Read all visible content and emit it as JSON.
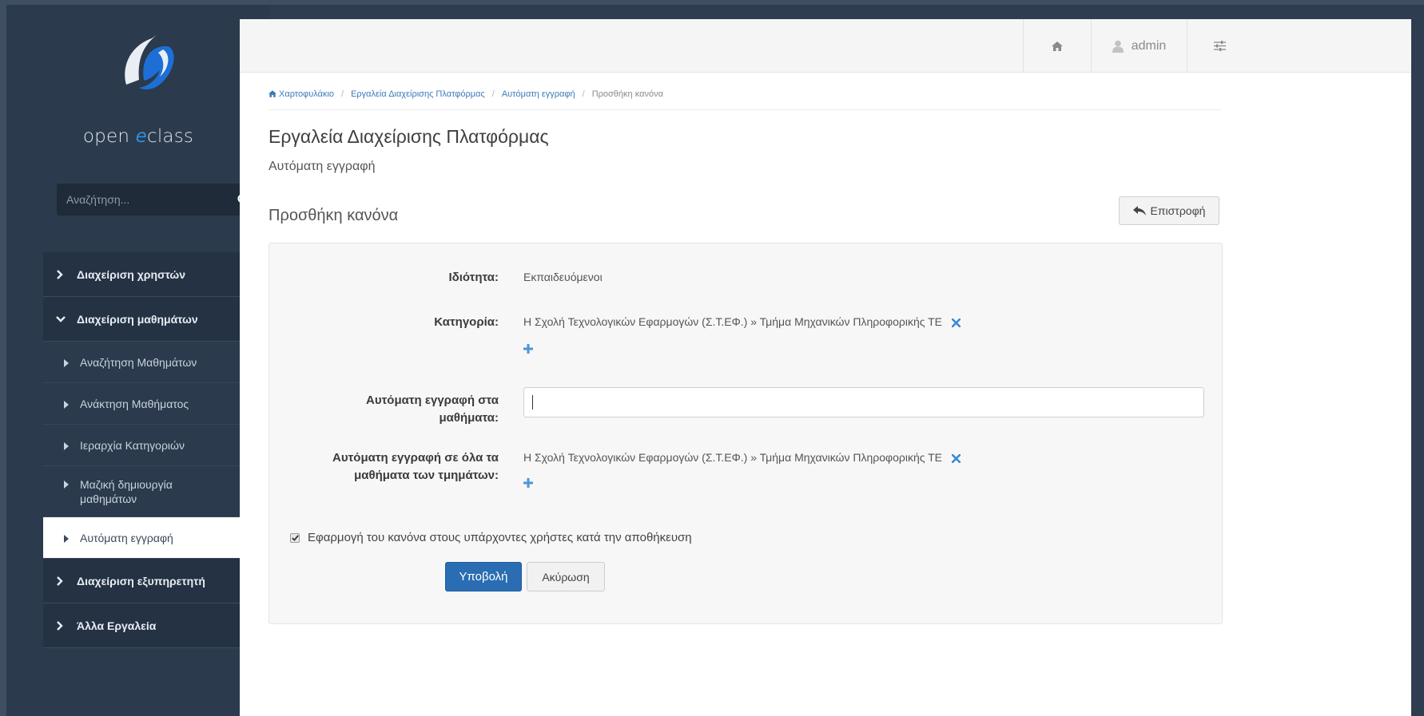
{
  "sidebar": {
    "logo_open": "open ",
    "logo_e": "e",
    "logo_class": "class",
    "search_placeholder": "Αναζήτηση...",
    "menu": [
      {
        "label": "Διαχείριση χρηστών"
      },
      {
        "label": "Διαχείριση μαθημάτων"
      },
      {
        "label": "Διαχείριση εξυπηρετητή"
      },
      {
        "label": "Άλλα Εργαλεία"
      }
    ],
    "submenu": [
      {
        "label": "Αναζήτηση Μαθημάτων"
      },
      {
        "label": "Ανάκτηση Μαθήματος"
      },
      {
        "label": "Ιεραρχία Κατηγοριών"
      },
      {
        "label": "Μαζική δημιουργία μαθημάτων"
      },
      {
        "label": "Αυτόματη εγγραφή"
      }
    ]
  },
  "topbar": {
    "user": "admin"
  },
  "breadcrumb": {
    "home": "Χαρτοφυλάκιο",
    "b1": "Εργαλεία Διαχείρισης Πλατφόρμας",
    "b2": "Αυτόματη εγγραφή",
    "current": "Προσθήκη κανόνα"
  },
  "page": {
    "title": "Εργαλεία Διαχείρισης Πλατφόρμας",
    "subtitle": "Αυτόματη εγγραφή",
    "section_title": "Προσθήκη κανόνα",
    "back_label": "Επιστροφή"
  },
  "form": {
    "property_label": "Ιδιότητα:",
    "property_value": "Εκπαιδευόμενοι",
    "category_label": "Κατηγορία:",
    "category_value": "Η Σχολή Τεχνολογικών Εφαρμογών (Σ.Τ.ΕΦ.) » Τμήμα Μηχανικών Πληροφορικής ΤΕ",
    "courses_label_1": "Αυτόματη εγγραφή στα",
    "courses_label_2": "μαθήματα:",
    "courses_input_value": "",
    "all_label_1": "Αυτόματη εγγραφή σε όλα τα",
    "all_label_2": "μαθήματα των τμημάτων:",
    "all_value": "Η Σχολή Τεχνολογικών Εφαρμογών (Σ.Τ.ΕΦ.) » Τμήμα Μηχανικών Πληροφορικής ΤΕ",
    "apply_checkbox_label": "Εφαρμογή του κανόνα στους υπάρχοντες χρήστες κατά την αποθήκευση",
    "apply_checked": true,
    "submit_label": "Υποβολή",
    "cancel_label": "Ακύρωση"
  },
  "colors": {
    "accent": "#2a6db2",
    "sidebar_bg": "#2b3a4c",
    "link": "#3d7ab8",
    "remove_x": "#3b88d6"
  },
  "icons": [
    "home-icon",
    "user-icon",
    "tune-icon",
    "search-icon",
    "reply-icon",
    "remove-icon",
    "plus-icon",
    "chevron-right-icon",
    "chevron-down-icon",
    "caret-right-icon",
    "check-icon"
  ]
}
